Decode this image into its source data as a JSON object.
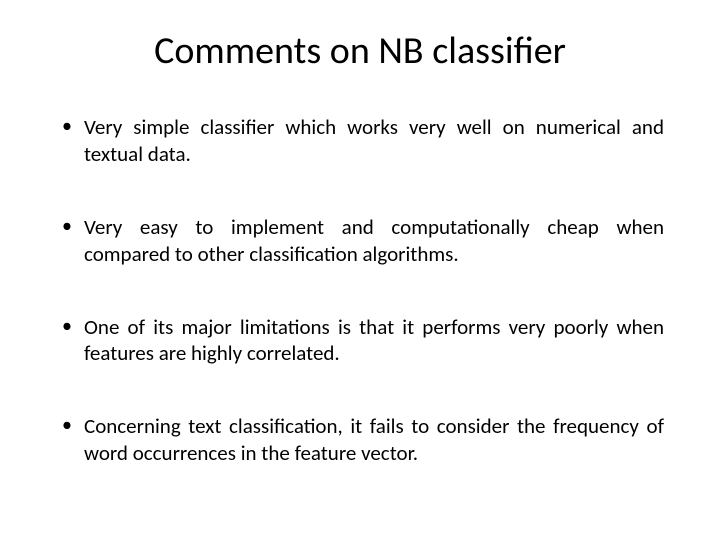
{
  "title": "Comments on NB classifier",
  "bullets": [
    "Very simple classifier which works very well on numerical and textual data.",
    "Very easy to implement and computationally cheap when compared to other classification algorithms.",
    "One of its major limitations is that it performs very poorly when features are highly correlated.",
    "Concerning text classification, it fails to consider the frequency of word occurrences in the feature vector."
  ]
}
